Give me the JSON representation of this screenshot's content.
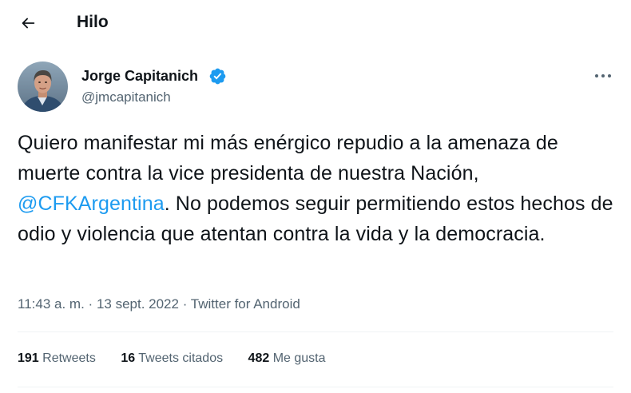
{
  "header": {
    "title": "Hilo",
    "back_icon": "arrow-left-icon"
  },
  "tweet": {
    "author_name": "Jorge Capitanich",
    "author_handle": "@jmcapitanich",
    "verified": true,
    "text_part1": "Quiero manifestar mi más enérgico repudio a la amenaza de muerte contra la vice presidenta de nuestra Nación, ",
    "mention": "@CFKArgentina",
    "text_part2": ". No podemos seguir permitiendo estos hechos de odio y violencia que atentan contra la vida y la democracia.",
    "time": "11:43 a. m.",
    "separator": "·",
    "date": "13 sept. 2022",
    "source": "Twitter for Android"
  },
  "stats": {
    "retweets_count": "191",
    "retweets_label": "Retweets",
    "quotes_count": "16",
    "quotes_label": "Tweets citados",
    "likes_count": "482",
    "likes_label": "Me gusta"
  },
  "colors": {
    "accent": "#1d9bf0",
    "text_primary": "#0f1419",
    "text_secondary": "#536471",
    "divider": "#eff3f4"
  }
}
